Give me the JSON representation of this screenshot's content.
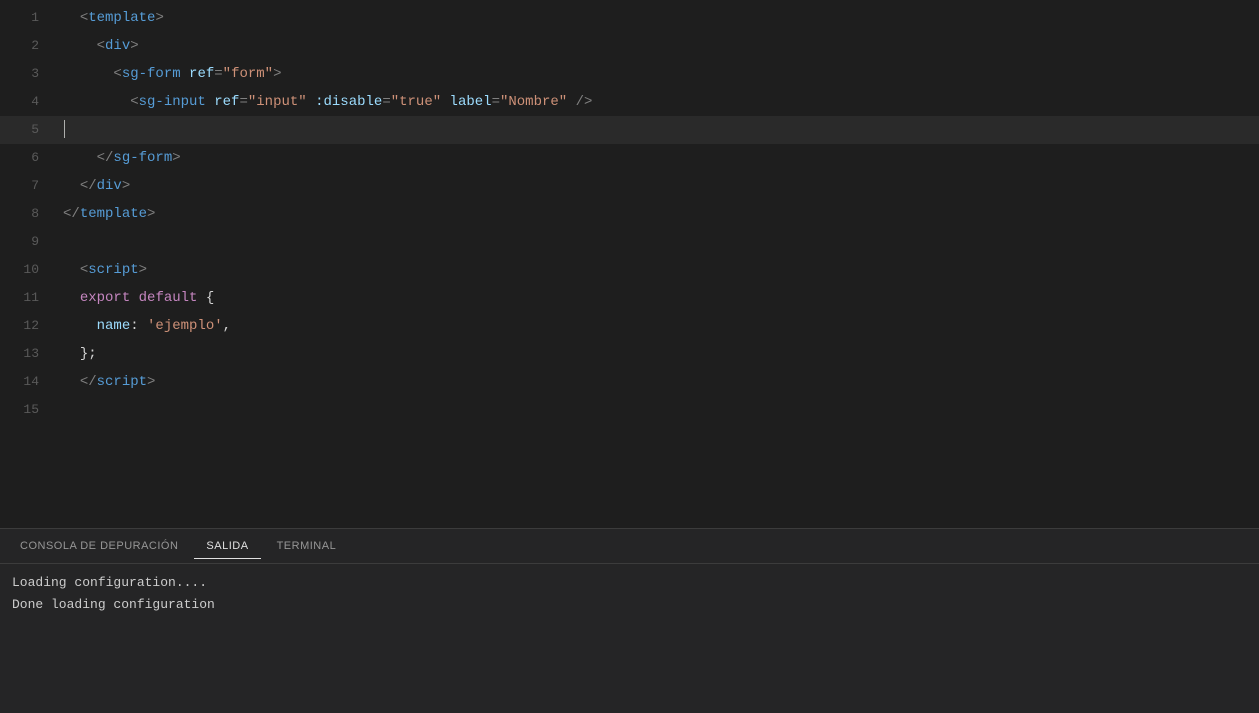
{
  "editor": {
    "lines": [
      {
        "number": 1,
        "tokens": [
          {
            "text": "  ",
            "class": "plain"
          },
          {
            "text": "<",
            "class": "punctuation"
          },
          {
            "text": "template",
            "class": "tag"
          },
          {
            "text": ">",
            "class": "punctuation"
          }
        ],
        "active": false
      },
      {
        "number": 2,
        "tokens": [
          {
            "text": "    ",
            "class": "plain"
          },
          {
            "text": "<",
            "class": "punctuation"
          },
          {
            "text": "div",
            "class": "tag"
          },
          {
            "text": ">",
            "class": "punctuation"
          }
        ],
        "active": false
      },
      {
        "number": 3,
        "tokens": [
          {
            "text": "      ",
            "class": "plain"
          },
          {
            "text": "<",
            "class": "punctuation"
          },
          {
            "text": "sg-form",
            "class": "tag"
          },
          {
            "text": " ",
            "class": "plain"
          },
          {
            "text": "ref",
            "class": "attr-name"
          },
          {
            "text": "=",
            "class": "punctuation"
          },
          {
            "text": "\"form\"",
            "class": "attr-value"
          },
          {
            "text": ">",
            "class": "punctuation"
          }
        ],
        "active": false
      },
      {
        "number": 4,
        "tokens": [
          {
            "text": "        ",
            "class": "plain"
          },
          {
            "text": "<",
            "class": "punctuation"
          },
          {
            "text": "sg-input",
            "class": "tag"
          },
          {
            "text": " ",
            "class": "plain"
          },
          {
            "text": "ref",
            "class": "attr-name"
          },
          {
            "text": "=",
            "class": "punctuation"
          },
          {
            "text": "\"input\"",
            "class": "attr-value"
          },
          {
            "text": " ",
            "class": "plain"
          },
          {
            "text": ":disable",
            "class": "attr-name"
          },
          {
            "text": "=",
            "class": "punctuation"
          },
          {
            "text": "\"true\"",
            "class": "attr-value"
          },
          {
            "text": " ",
            "class": "plain"
          },
          {
            "text": "label",
            "class": "attr-name"
          },
          {
            "text": "=",
            "class": "punctuation"
          },
          {
            "text": "\"Nombre\"",
            "class": "attr-value"
          },
          {
            "text": " />",
            "class": "punctuation"
          }
        ],
        "active": false
      },
      {
        "number": 5,
        "tokens": [],
        "active": true,
        "cursor": true
      },
      {
        "number": 6,
        "tokens": [
          {
            "text": "    ",
            "class": "plain"
          },
          {
            "text": "</",
            "class": "punctuation"
          },
          {
            "text": "sg-form",
            "class": "tag"
          },
          {
            "text": ">",
            "class": "punctuation"
          }
        ],
        "active": false
      },
      {
        "number": 7,
        "tokens": [
          {
            "text": "  ",
            "class": "plain"
          },
          {
            "text": "</",
            "class": "punctuation"
          },
          {
            "text": "div",
            "class": "tag"
          },
          {
            "text": ">",
            "class": "punctuation"
          }
        ],
        "active": false
      },
      {
        "number": 8,
        "tokens": [
          {
            "text": "</",
            "class": "punctuation"
          },
          {
            "text": "template",
            "class": "tag"
          },
          {
            "text": ">",
            "class": "punctuation"
          }
        ],
        "active": false
      },
      {
        "number": 9,
        "tokens": [],
        "active": false
      },
      {
        "number": 10,
        "tokens": [
          {
            "text": "  ",
            "class": "plain"
          },
          {
            "text": "<",
            "class": "punctuation"
          },
          {
            "text": "script",
            "class": "tag"
          },
          {
            "text": ">",
            "class": "punctuation"
          }
        ],
        "active": false
      },
      {
        "number": 11,
        "tokens": [
          {
            "text": "  ",
            "class": "plain"
          },
          {
            "text": "export",
            "class": "keyword"
          },
          {
            "text": " ",
            "class": "plain"
          },
          {
            "text": "default",
            "class": "keyword"
          },
          {
            "text": " {",
            "class": "plain"
          }
        ],
        "active": false
      },
      {
        "number": 12,
        "tokens": [
          {
            "text": "    ",
            "class": "plain"
          },
          {
            "text": "name",
            "class": "prop-name"
          },
          {
            "text": ": ",
            "class": "plain"
          },
          {
            "text": "'ejemplo'",
            "class": "string"
          },
          {
            "text": ",",
            "class": "plain"
          }
        ],
        "active": false
      },
      {
        "number": 13,
        "tokens": [
          {
            "text": "  ",
            "class": "plain"
          },
          {
            "text": "};",
            "class": "plain"
          }
        ],
        "active": false
      },
      {
        "number": 14,
        "tokens": [
          {
            "text": "  ",
            "class": "plain"
          },
          {
            "text": "</",
            "class": "punctuation"
          },
          {
            "text": "script",
            "class": "tag"
          },
          {
            "text": ">",
            "class": "punctuation"
          }
        ],
        "active": false
      },
      {
        "number": 15,
        "tokens": [],
        "active": false
      }
    ]
  },
  "panel": {
    "tabs": [
      {
        "id": "debug",
        "label": "CONSOLA DE DEPURACIÓN",
        "active": false
      },
      {
        "id": "output",
        "label": "SALIDA",
        "active": true
      },
      {
        "id": "terminal",
        "label": "TERMINAL",
        "active": false
      }
    ],
    "output_lines": [
      "Loading configuration....",
      "Done loading configuration"
    ]
  }
}
